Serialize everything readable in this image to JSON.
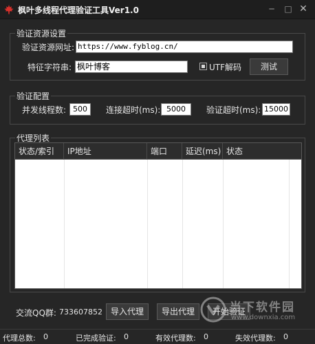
{
  "window": {
    "title": "枫叶多线程代理验证工具Ver1.0",
    "minimize_glyph": "─",
    "maximize_glyph": "□",
    "close_glyph": "✕"
  },
  "source_group": {
    "title": "验证资源设置",
    "url_label": "验证资源网址:",
    "url_value": "https://www.fyblog.cn/",
    "feature_label": "特征字符串:",
    "feature_value": "枫叶博客",
    "utf_decode_label": "UTF解码",
    "utf_decode_checked": true,
    "test_button": "测试"
  },
  "config_group": {
    "title": "验证配置",
    "threads_label": "并发线程数:",
    "threads_value": "500",
    "connect_timeout_label": "连接超时(ms):",
    "connect_timeout_value": "5000",
    "verify_timeout_label": "验证超时(ms):",
    "verify_timeout_value": "15000"
  },
  "proxy_list": {
    "title": "代理列表",
    "columns": [
      "状态/索引",
      "IP地址",
      "端口",
      "延迟(ms)",
      "状态"
    ],
    "rows": []
  },
  "bottom": {
    "qq_label": "交流QQ群:",
    "qq_value": "733607852",
    "import_button": "导入代理",
    "export_button": "导出代理",
    "start_button": "开始验证"
  },
  "statusbar": {
    "total_label": "代理总数:",
    "total_value": "0",
    "done_label": "已完成验证:",
    "done_value": "0",
    "valid_label": "有效代理数:",
    "valid_value": "0",
    "invalid_label": "失效代理数:",
    "invalid_value": "0"
  },
  "watermark": {
    "name": "当下软件园",
    "url": "www.downxia.com",
    "logo_icon": "downxia-logo-icon"
  },
  "colors": {
    "background": "#262626",
    "titlebar": "#1e1e1e",
    "app_icon": "#d9302b",
    "field_background": "#ffffff"
  }
}
